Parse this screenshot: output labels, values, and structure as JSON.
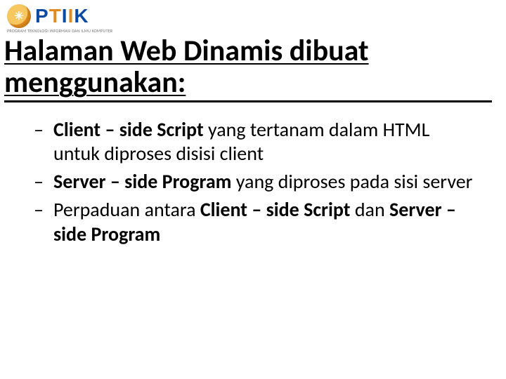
{
  "logo": {
    "mark_glyph": "✳",
    "letters": {
      "p": "P",
      "t": "T",
      "i1": "I",
      "i2": "I",
      "k": "K"
    },
    "sub": "PROGRAM TEKNOLOGI INFORMASI DAN ILMU KOMPUTER"
  },
  "title": "Halaman Web Dinamis dibuat menggunakan:",
  "bullets": [
    {
      "dash": "–",
      "parts": [
        {
          "t": "Client – side Script",
          "b": true
        },
        {
          "t": " yang tertanam dalam HTML untuk diproses disisi client",
          "b": false
        }
      ]
    },
    {
      "dash": "–",
      "parts": [
        {
          "t": "Server – side Program",
          "b": true
        },
        {
          "t": " yang diproses pada sisi server",
          "b": false
        }
      ]
    },
    {
      "dash": "–",
      "parts": [
        {
          "t": "Perpaduan antara ",
          "b": false
        },
        {
          "t": "Client – side Script",
          "b": true
        },
        {
          "t": "  dan ",
          "b": false
        },
        {
          "t": "Server – side Program",
          "b": true
        }
      ]
    }
  ]
}
